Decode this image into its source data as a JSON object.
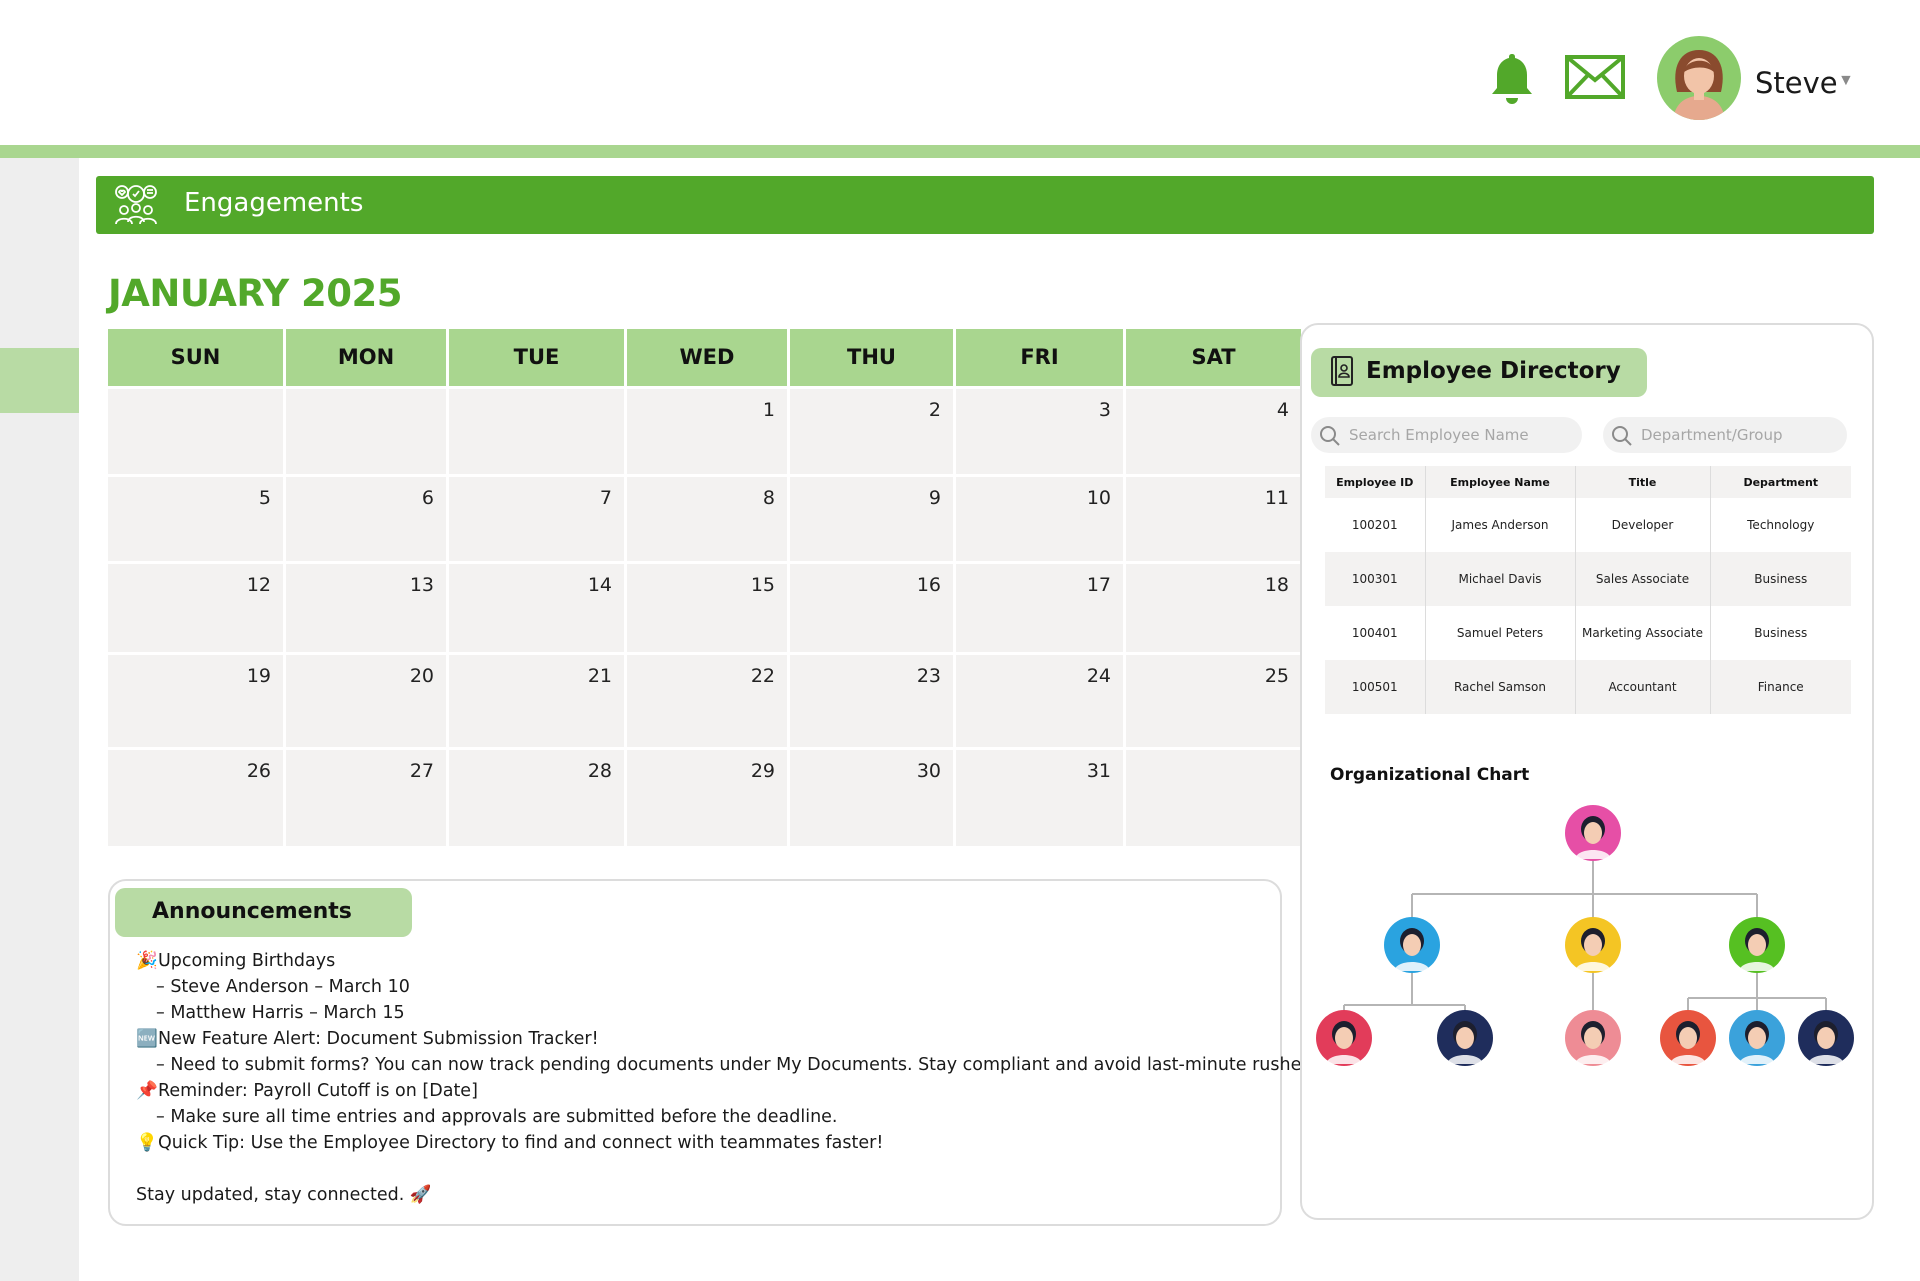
{
  "header": {
    "user_name": "Steve",
    "icons": [
      "bell-icon",
      "mail-icon",
      "avatar",
      "caret-down-icon"
    ],
    "accent": "#52a82a"
  },
  "banner": {
    "title": "Engagements"
  },
  "calendar": {
    "title": "JANUARY 2025",
    "days": [
      "SUN",
      "MON",
      "TUE",
      "WED",
      "THU",
      "FRI",
      "SAT"
    ],
    "weeks": [
      [
        "",
        "",
        "",
        "1",
        "2",
        "3",
        "4"
      ],
      [
        "5",
        "6",
        "7",
        "8",
        "9",
        "10",
        "11"
      ],
      [
        "12",
        "13",
        "14",
        "15",
        "16",
        "17",
        "18"
      ],
      [
        "19",
        "20",
        "21",
        "22",
        "23",
        "24",
        "25"
      ],
      [
        "26",
        "27",
        "28",
        "29",
        "30",
        "31",
        ""
      ]
    ]
  },
  "announcements": {
    "title": "Announcements",
    "lines": [
      {
        "emoji": "🎉",
        "text": "Upcoming Birthdays",
        "sub": false
      },
      {
        "emoji": "",
        "text": "– Steve Anderson – March 10",
        "sub": true
      },
      {
        "emoji": "",
        "text": "– Matthew Harris – March 15",
        "sub": true
      },
      {
        "emoji": "🆕",
        "text": "New Feature Alert: Document Submission Tracker!",
        "sub": false
      },
      {
        "emoji": "",
        "text": "– Need to submit forms? You can now track pending documents under My Documents. Stay compliant and avoid last-minute rushes!",
        "sub": true
      },
      {
        "emoji": "📌",
        "text": "Reminder: Payroll Cutoff is on [Date]",
        "sub": false
      },
      {
        "emoji": "",
        "text": "– Make sure all time entries and approvals are submitted before the deadline.",
        "sub": true
      },
      {
        "emoji": "💡",
        "text": "Quick Tip: Use the Employee Directory to find and connect with teammates faster!",
        "sub": false
      }
    ],
    "closing": "Stay updated, stay connected. 🚀"
  },
  "directory": {
    "title": "Employee Directory",
    "search_placeholder": "Search Employee Name",
    "dept_placeholder": "Department/Group",
    "columns": [
      "Employee ID",
      "Employee Name",
      "Title",
      "Department"
    ],
    "rows": [
      [
        "100201",
        "James Anderson",
        "Developer",
        "Technology"
      ],
      [
        "100301",
        "Michael Davis",
        "Sales Associate",
        "Business"
      ],
      [
        "100401",
        "Samuel Peters",
        "Marketing Associate",
        "Business"
      ],
      [
        "100501",
        "Rachel Samson",
        "Accountant",
        "Finance"
      ]
    ]
  },
  "org_chart": {
    "title": "Organizational Chart",
    "avatar_colors": {
      "top": "#e64fa6",
      "level2": [
        "#2aa3e0",
        "#f4c524",
        "#56c022"
      ],
      "level3": [
        "#e23c5a",
        "#1f2d5c",
        "#ee8c95",
        "#e8553f",
        "#3ba2db",
        "#1f2d5c"
      ]
    }
  }
}
